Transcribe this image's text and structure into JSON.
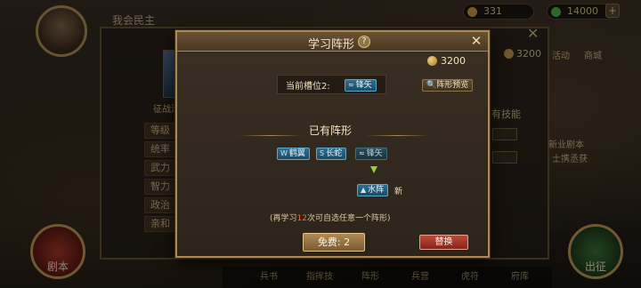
{
  "background": {
    "top_title": "我会民主",
    "resources": [
      {
        "value": "331",
        "color": "#d8a24a"
      },
      {
        "value": "14000",
        "color": "#4fbf4a"
      }
    ],
    "coin_right": "3200",
    "side_label_1": "征战活动",
    "side_label_2": "活动",
    "side_label_3": "商城",
    "stats": [
      "等级",
      "统率",
      "武力",
      "智力",
      "政治",
      "亲和"
    ],
    "skills_label": "有技能",
    "new_dungeon": "新业剧本",
    "right_sub": "士携丞获",
    "left_round_label": "剧本",
    "right_round_label": "出征",
    "bottom_items": [
      "兵书",
      "指挥技",
      "阵形",
      "兵营",
      "虎符",
      "府库"
    ]
  },
  "dialog": {
    "title": "学习阵形",
    "help_symbol": "?",
    "close_symbol": "✕",
    "coin_amount": "3200",
    "current_slot_label": "当前槽位2:",
    "current_formation": {
      "icon": "≈",
      "name": "锋矢"
    },
    "preview_button": "阵形预览",
    "owned_section_title": "已有阵形",
    "owned_formations": [
      {
        "icon": "W",
        "name": "鹤翼"
      },
      {
        "icon": "S",
        "name": "长蛇"
      },
      {
        "icon": "≈",
        "name": "锋矢"
      }
    ],
    "new_formation": {
      "icon": "▲",
      "name": "水阵"
    },
    "new_badge": "新",
    "hint_prefix": "(再学习",
    "hint_count": "12",
    "hint_suffix": "次可自选任意一个阵形)",
    "free_button": "免费: 2",
    "replace_button": "替换"
  }
}
